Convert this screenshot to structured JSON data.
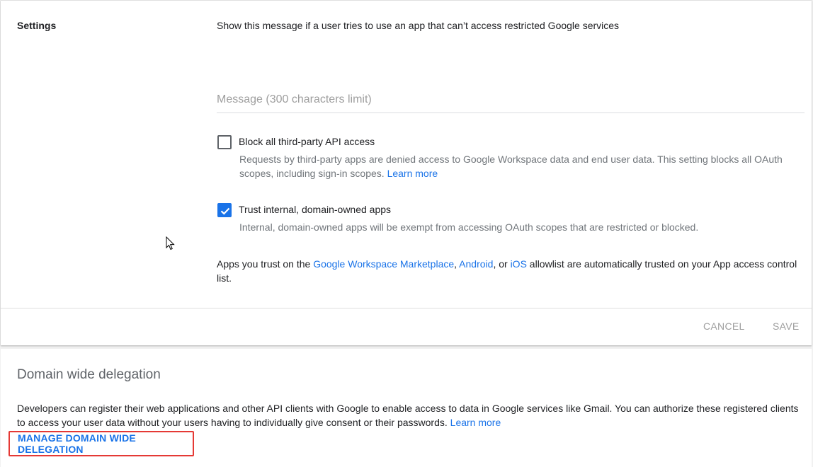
{
  "settings": {
    "label": "Settings",
    "description": "Show this message if a user tries to use an app that can’t access restricted Google services",
    "message_placeholder": "Message (300 characters limit)",
    "message_value": "",
    "block_api": {
      "label": "Block all third-party API access",
      "checked": false,
      "help": "Requests by third-party apps are denied access to Google Workspace data and end user data. This setting blocks all OAuth scopes, including sign-in scopes.",
      "link": "Learn more"
    },
    "trust_internal": {
      "label": "Trust internal, domain-owned apps",
      "checked": true,
      "help": "Internal, domain-owned apps will be exempt from accessing OAuth scopes that are restricted or blocked."
    },
    "trust_note": {
      "prefix": "Apps you trust on the ",
      "link_marketplace": "Google Workspace Marketplace",
      "sep1": ", ",
      "link_android": "Android",
      "sep2": ", or ",
      "link_ios": "iOS",
      "suffix": " allowlist are automatically trusted on your App access control list."
    },
    "cancel_label": "CANCEL",
    "save_label": "SAVE"
  },
  "delegation": {
    "title": "Domain wide delegation",
    "description": "Developers can register their web applications and other API clients with Google to enable access to data in Google services like Gmail. You can authorize these registered clients to access your user data without your users having to individually give consent or their passwords.",
    "link": "Learn more",
    "manage_label": "MANAGE DOMAIN WIDE DELEGATION"
  },
  "colors": {
    "accent": "#1a73e8",
    "highlight_border": "#e53935",
    "disabled_text": "#9e9e9e"
  }
}
